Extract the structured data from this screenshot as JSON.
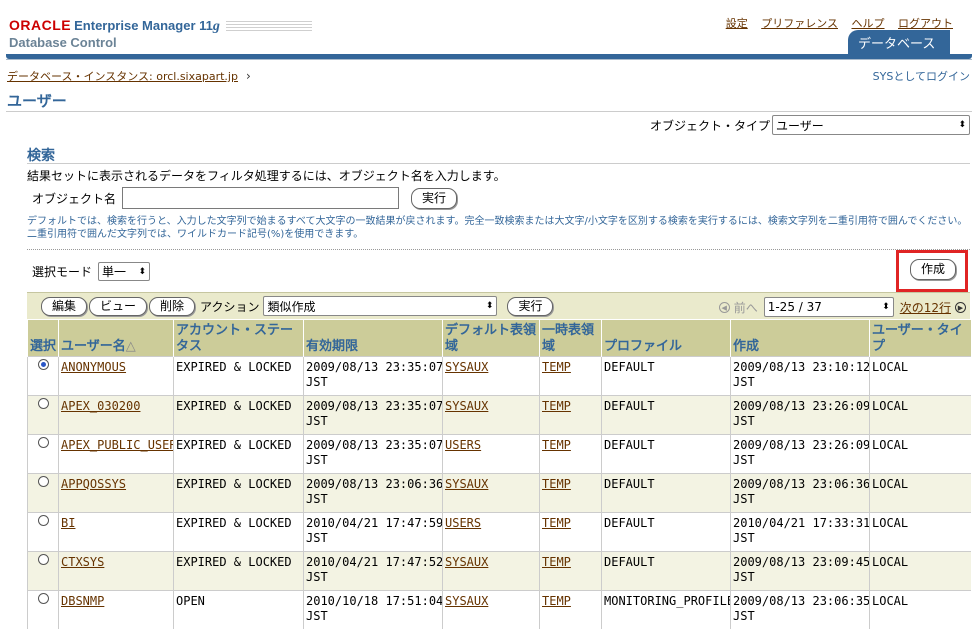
{
  "header": {
    "brand_oracle": "ORACLE",
    "brand_em": "Enterprise Manager 11",
    "brand_em_suffix": "g",
    "brand_sub": "Database Control",
    "global_links": [
      "設定",
      "プリファレンス",
      "ヘルプ",
      "ログアウト"
    ],
    "db_tab": "データベース"
  },
  "breadcrumb": {
    "label": "データベース・インスタンス: orcl.sixapart.jp",
    "login_as": "SYSとしてログイン"
  },
  "page_title": "ユーザー",
  "object_type": {
    "label": "オブジェクト・タイプ",
    "value": "ユーザー"
  },
  "search": {
    "title": "検索",
    "description": "結果セットに表示されるデータをフィルタ処理するには、オブジェクト名を入力します。",
    "object_name_label": "オブジェクト名",
    "object_name_value": "",
    "go_label": "実行",
    "hint": "デフォルトでは、検索を行うと、入力した文字列で始まるすべて大文字の一致結果が戻されます。完全一致検索または大文字/小文字を区別する検索を実行するには、検索文字列を二重引用符で囲んでください。二重引用符で囲んだ文字列では、ワイルドカード記号(%)を使用できます。"
  },
  "selection_mode": {
    "label": "選択モード",
    "value": "単一"
  },
  "create_label": "作成",
  "toolbar": {
    "edit": "編集",
    "view": "ビュー",
    "delete": "削除",
    "action_label": "アクション",
    "action_value": "類似作成",
    "go": "実行",
    "prev": "前へ",
    "range": "1-25 / 37",
    "next": "次の12行"
  },
  "table": {
    "headers": [
      "選択",
      "ユーザー名",
      "アカウント・ステータス",
      "有効期限",
      "デフォルト表領域",
      "一時表領域",
      "プロファイル",
      "作成",
      "ユーザー・タイプ"
    ],
    "sort_indicator": "△",
    "rows": [
      {
        "selected": true,
        "user": "ANONYMOUS",
        "status": "EXPIRED & LOCKED",
        "expire": "2009/08/13 23:35:07",
        "expire_tz": "JST",
        "deftbs": "SYSAUX",
        "temp": "TEMP",
        "profile": "DEFAULT",
        "created": "2009/08/13 23:10:12",
        "created_tz": "JST",
        "type": "LOCAL"
      },
      {
        "selected": false,
        "user": "APEX_030200",
        "status": "EXPIRED & LOCKED",
        "expire": "2009/08/13 23:35:07",
        "expire_tz": "JST",
        "deftbs": "SYSAUX",
        "temp": "TEMP",
        "profile": "DEFAULT",
        "created": "2009/08/13 23:26:09",
        "created_tz": "JST",
        "type": "LOCAL"
      },
      {
        "selected": false,
        "user": "APEX_PUBLIC_USER",
        "status": "EXPIRED & LOCKED",
        "expire": "2009/08/13 23:35:07",
        "expire_tz": "JST",
        "deftbs": "USERS",
        "temp": "TEMP",
        "profile": "DEFAULT",
        "created": "2009/08/13 23:26:09",
        "created_tz": "JST",
        "type": "LOCAL"
      },
      {
        "selected": false,
        "user": "APPQOSSYS",
        "status": "EXPIRED & LOCKED",
        "expire": "2009/08/13 23:06:36",
        "expire_tz": "JST",
        "deftbs": "SYSAUX",
        "temp": "TEMP",
        "profile": "DEFAULT",
        "created": "2009/08/13 23:06:36",
        "created_tz": "JST",
        "type": "LOCAL"
      },
      {
        "selected": false,
        "user": "BI",
        "status": "EXPIRED & LOCKED",
        "expire": "2010/04/21 17:47:59",
        "expire_tz": "JST",
        "deftbs": "USERS",
        "temp": "TEMP",
        "profile": "DEFAULT",
        "created": "2010/04/21 17:33:31",
        "created_tz": "JST",
        "type": "LOCAL"
      },
      {
        "selected": false,
        "user": "CTXSYS",
        "status": "EXPIRED & LOCKED",
        "expire": "2010/04/21 17:47:52",
        "expire_tz": "JST",
        "deftbs": "SYSAUX",
        "temp": "TEMP",
        "profile": "DEFAULT",
        "created": "2009/08/13 23:09:45",
        "created_tz": "JST",
        "type": "LOCAL"
      },
      {
        "selected": false,
        "user": "DBSNMP",
        "status": "OPEN",
        "expire": "2010/10/18 17:51:04",
        "expire_tz": "JST",
        "deftbs": "SYSAUX",
        "temp": "TEMP",
        "profile": "MONITORING_PROFILE",
        "created": "2009/08/13 23:06:35",
        "created_tz": "JST",
        "type": "LOCAL"
      }
    ]
  }
}
